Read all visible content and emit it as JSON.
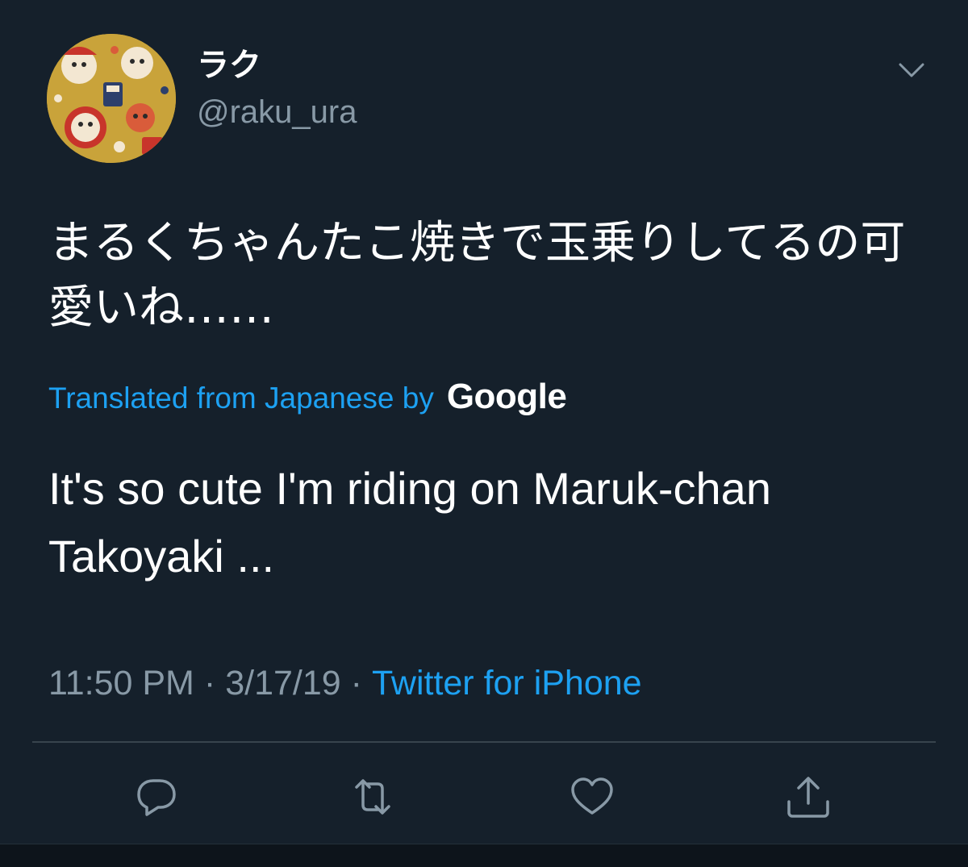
{
  "user": {
    "display_name": "ラク",
    "handle": "@raku_ura"
  },
  "tweet": {
    "original_text": "まるくちゃんたこ焼きで玉乗りしてるの可愛いね……",
    "translation_label": "Translated from Japanese by",
    "translation_provider": "Google",
    "translated_text": "It's so cute I'm riding on Maruk-chan Takoyaki ...",
    "time": "11:50 PM",
    "date": "3/17/19",
    "source": "Twitter for iPhone",
    "separator": "·"
  },
  "icons": {
    "menu": "chevron-down-icon",
    "reply": "reply-icon",
    "retweet": "retweet-icon",
    "like": "heart-icon",
    "share": "share-icon"
  },
  "colors": {
    "background": "#15202b",
    "accent": "#1da1f2",
    "muted": "#8899a6",
    "divider": "#38444d",
    "avatar_bg": "#c9a33a"
  }
}
